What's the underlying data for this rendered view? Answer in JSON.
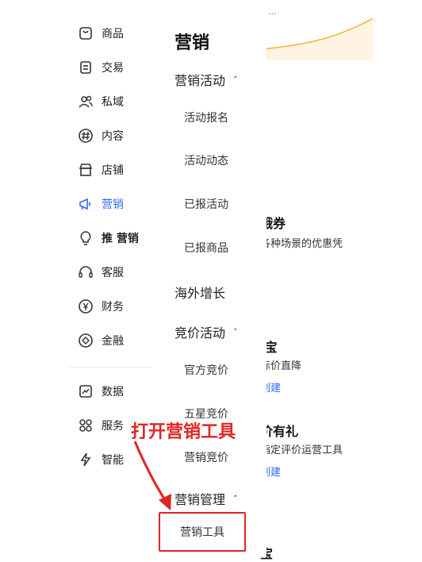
{
  "sidebar": {
    "items": [
      {
        "label": "商品",
        "icon": "product-icon"
      },
      {
        "label": "交易",
        "icon": "order-icon"
      },
      {
        "label": "私域",
        "icon": "users-icon"
      },
      {
        "label": "内容",
        "icon": "hashtag-icon"
      },
      {
        "label": "店铺",
        "icon": "store-icon"
      },
      {
        "label": "营销",
        "icon": "megaphone-icon"
      },
      {
        "label": "推 营销",
        "icon": "bulb-icon"
      },
      {
        "label": "客服",
        "icon": "headset-icon"
      },
      {
        "label": "财务",
        "icon": "yen-icon"
      },
      {
        "label": "金融",
        "icon": "finance-icon"
      },
      {
        "label": "数据",
        "icon": "chart-icon"
      },
      {
        "label": "服务",
        "icon": "grid-icon"
      },
      {
        "label": "智能",
        "icon": "lightning-icon"
      }
    ],
    "active_color": "#2f6bff"
  },
  "submenu": {
    "title": "营销",
    "groups": [
      {
        "label": "营销活动",
        "caret": "˄",
        "items": [
          "活动报名",
          "活动动态",
          "已报活动",
          "已报商品"
        ]
      },
      {
        "label": "海外增长"
      },
      {
        "label": "竞价活动",
        "caret": "˄",
        "items": [
          "官方竞价",
          "五星竞价",
          "营销竞价"
        ]
      },
      {
        "label": "营销管理",
        "caret": "˄",
        "items": [
          "营销工具"
        ]
      }
    ]
  },
  "annotation": {
    "text": "打开营销工具",
    "color": "#e02424"
  },
  "right_panel": {
    "top_text": "...",
    "cards": [
      {
        "title": "哦券",
        "desc": "各种场景的优惠凭"
      },
      {
        "title": "i宝",
        "desc": "标价直降",
        "link": "创建"
      },
      {
        "title": "价有礼",
        "desc": "指定评价运营工具",
        "link": "创建"
      },
      {
        "title": "宝"
      }
    ],
    "link_color": "#2f6bff"
  }
}
